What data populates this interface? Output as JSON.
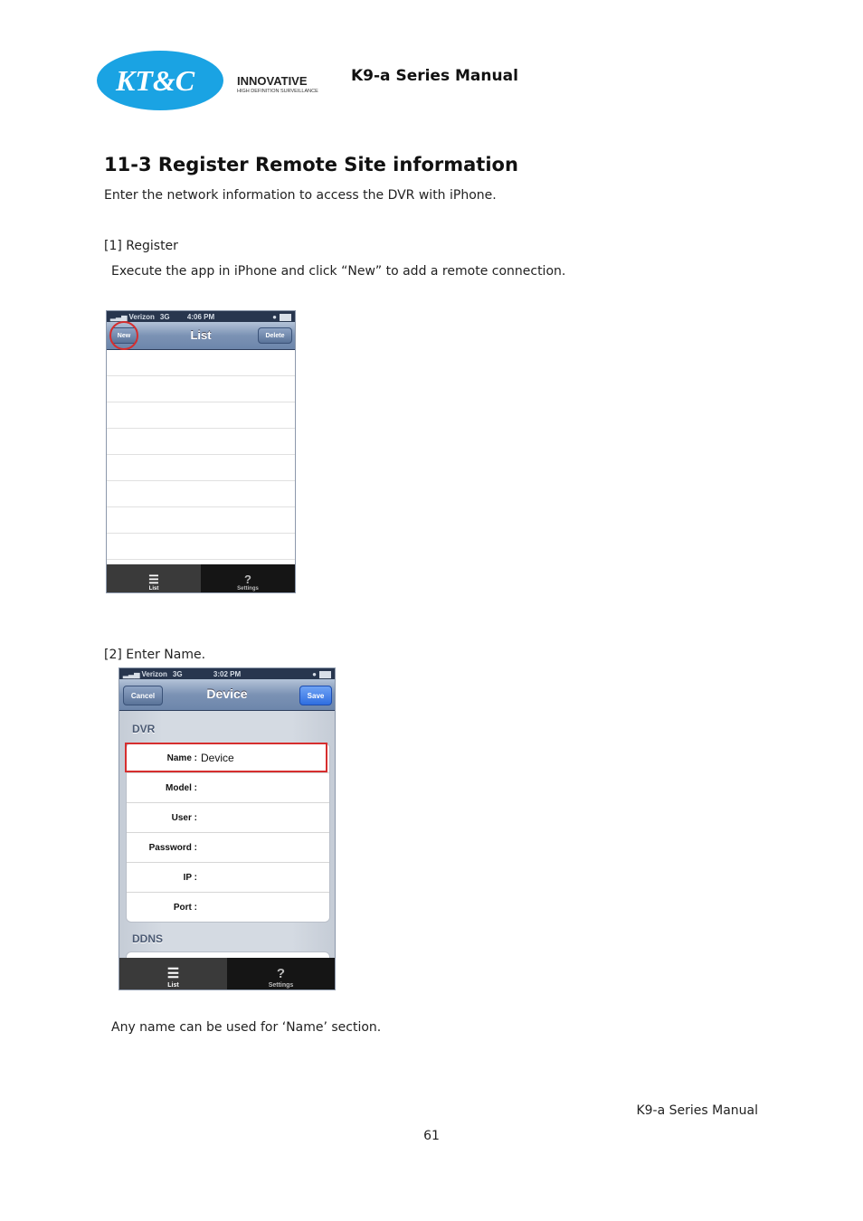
{
  "header": {
    "logo_text": "KT&C",
    "logo_tagline": "INNOVATIVE",
    "logo_subtagline": "HIGH DEFINITION SURVEILLANCE",
    "manual_title": "K9-a Series Manual"
  },
  "section": {
    "title": "11-3 Register Remote Site information",
    "intro": "Enter the network information to access the DVR with iPhone."
  },
  "step1": {
    "heading": "[1] Register",
    "text": "Execute the app in iPhone and click “New” to add a remote connection."
  },
  "screen1": {
    "carrier": "Verizon",
    "network": "3G",
    "time": "4:06 PM",
    "nav_title": "List",
    "new_button": "New",
    "delete_button": "Delete",
    "tabs": [
      "List",
      "Settings"
    ],
    "settings_glyph": "?",
    "highlight_color": "#d62e2e"
  },
  "step2": {
    "heading": "[2] Enter Name."
  },
  "screen2": {
    "carrier": "Verizon",
    "network": "3G",
    "time": "3:02 PM",
    "nav_title": "Device",
    "cancel_button": "Cancel",
    "save_button": "Save",
    "group1": "DVR",
    "fields": [
      {
        "label": "Name :",
        "value": "Device"
      },
      {
        "label": "Model :",
        "value": ""
      },
      {
        "label": "User :",
        "value": ""
      },
      {
        "label": "Password :",
        "value": ""
      },
      {
        "label": "IP :",
        "value": ""
      },
      {
        "label": "Port :",
        "value": ""
      }
    ],
    "group2": "DDNS",
    "tabs": [
      "List",
      "Settings"
    ],
    "settings_glyph": "?",
    "highlight_color": "#d62e2e"
  },
  "note": "Any name can be used for ‘Name’ section.",
  "footer": {
    "manual_title": "K9-a Series Manual",
    "page_number": "61"
  }
}
